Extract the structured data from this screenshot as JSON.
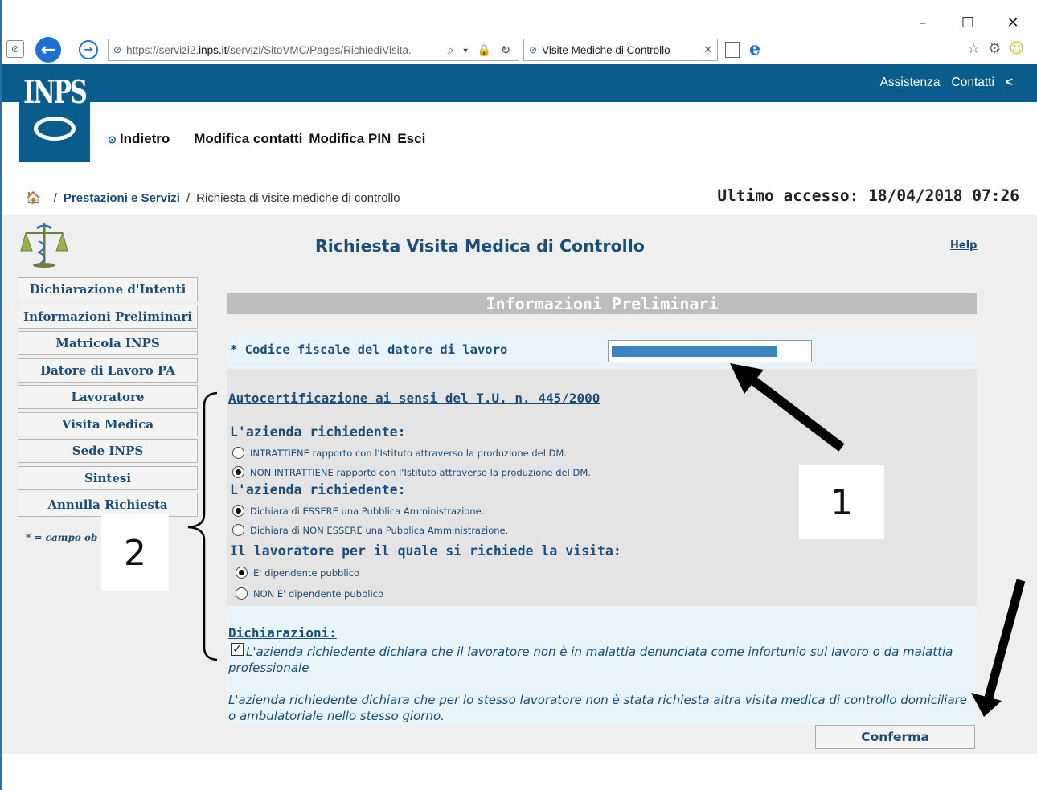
{
  "browser": {
    "window_controls": {
      "minimize": "–",
      "maximize": "☐",
      "close": "✕"
    },
    "url_prefix": "https://servizi2.",
    "url_domain": "inps.it",
    "url_suffix": "/servizi/SitoVMC/Pages/RichiediVisita.",
    "address_tools": "⌕ ▾ 🔒 ↻",
    "tab_title": "Visite Mediche di Controllo",
    "tab_close": "✕",
    "tools": {
      "favorites": "☆",
      "settings": "⚙",
      "feedback": "☺"
    },
    "nav": {
      "back_glyph": "←",
      "forward_glyph": "→",
      "site_glyph": "⊘",
      "edge_glyph": "e"
    }
  },
  "header": {
    "logo_text": "INPS",
    "links": [
      "Assistenza",
      "Contatti"
    ],
    "share_glyph": "<",
    "subnav": {
      "back_label": "Indietro",
      "back_glyph": "⊙",
      "items": [
        "Modifica contatti",
        "Modifica PIN",
        "Esci"
      ]
    }
  },
  "breadcrumb": {
    "home_glyph": "🏠",
    "separator": "/",
    "items": [
      "Prestazioni e Servizi",
      "Richiesta di visite mediche di controllo"
    ]
  },
  "last_access": "Ultimo accesso: 18/04/2018 07:26",
  "page": {
    "title": "Richiesta Visita Medica di Controllo",
    "help": "Help"
  },
  "side_menu": {
    "items": [
      "Dichiarazione d'Intenti",
      "Informazioni Preliminari",
      "Matricola INPS",
      "Datore di Lavoro PA",
      "Lavoratore",
      "Visita Medica",
      "Sede INPS",
      "Sintesi",
      "Annulla Richiesta"
    ],
    "note": "* = campo ob"
  },
  "form": {
    "section_title": "Informazioni Preliminari",
    "cf_label": "* Codice fiscale del datore di lavoro",
    "autocert_title": "Autocertificazione ai sensi del T.U. n. 445/2000",
    "q1": {
      "title": "L'azienda richiedente:",
      "options": [
        {
          "label": "INTRATTIENE rapporto con l'Istituto attraverso la produzione del DM.",
          "selected": false
        },
        {
          "label": "NON INTRATTIENE rapporto con l'Istituto attraverso la produzione del DM.",
          "selected": true
        }
      ]
    },
    "q2": {
      "title": "L'azienda richiedente:",
      "options": [
        {
          "label": "Dichiara di ESSERE una Pubblica Amministrazione.",
          "selected": true
        },
        {
          "label": "Dichiara di NON ESSERE una Pubblica Amministrazione.",
          "selected": false
        }
      ]
    },
    "q3": {
      "title": "Il lavoratore per il quale si richiede la visita:",
      "options": [
        {
          "label": "E' dipendente pubblico",
          "selected": true
        },
        {
          "label": "NON E' dipendente pubblico",
          "selected": false
        }
      ]
    },
    "declarations_title": "Dichiarazioni:",
    "declaration_check_glyph": "✓",
    "declaration_1": "L'azienda richiedente dichiara che il lavoratore non è in malattia denunciata come infortunio sul lavoro o da malattia professionale",
    "declaration_2": "L'azienda richiedente dichiara che per lo stesso lavoratore non è stata richiesta altra visita medica di controllo domiciliare o ambulatoriale nello stesso giorno.",
    "confirm_label": "Conferma"
  },
  "annotations": {
    "label_1": "1",
    "label_2": "2"
  },
  "colors": {
    "brand_blue": "#0a5c8d",
    "text_blue": "#1a4e7a",
    "section_gray": "#bdbdbd"
  }
}
